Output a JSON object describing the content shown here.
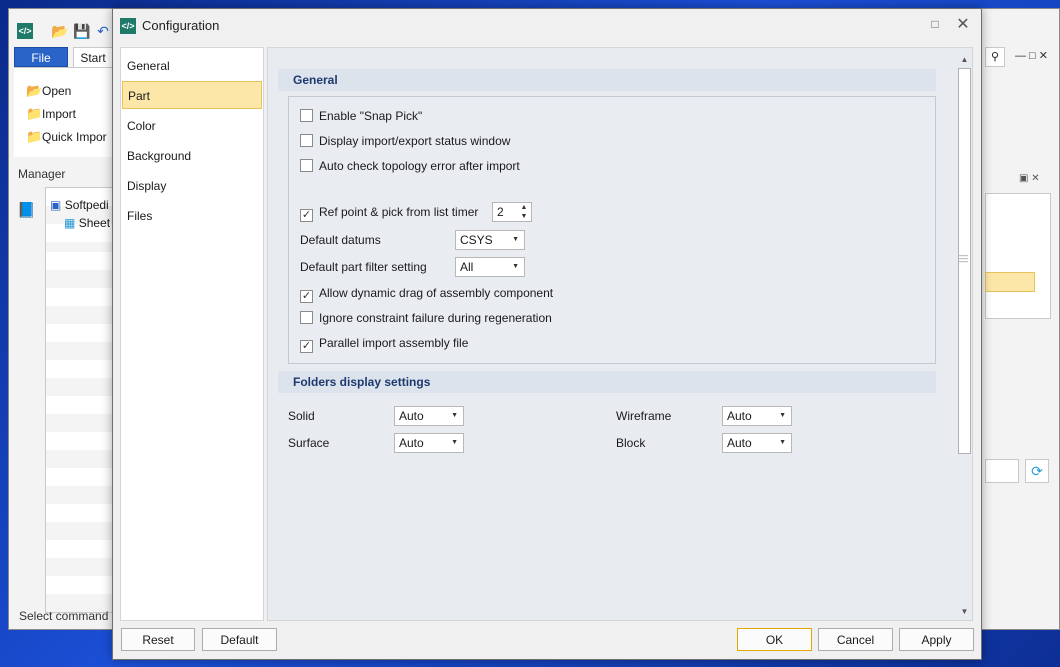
{
  "app": {
    "tabs": {
      "file": "File",
      "start": "Start"
    },
    "ribbon": {
      "open": "Open",
      "import": "Import",
      "quick_import": "Quick Impor"
    },
    "manager_label": "Manager",
    "tree": {
      "item1": "Softpedi",
      "item2": "Sheet"
    },
    "status": "Select command o"
  },
  "dialog": {
    "title": "Configuration",
    "nav": [
      "General",
      "Part",
      "Color",
      "Background",
      "Display",
      "Files"
    ],
    "nav_selected": "Part",
    "sections": {
      "general": "General",
      "folders": "Folders display settings"
    },
    "options": {
      "snap_pick": {
        "label": "Enable \"Snap Pick\"",
        "checked": false
      },
      "status_window": {
        "label": "Display import/export status window",
        "checked": false
      },
      "topology": {
        "label": "Auto check topology error after import",
        "checked": false
      },
      "ref_point": {
        "label": "Ref point & pick from list timer",
        "checked": true,
        "value": "2"
      },
      "dynamic_drag": {
        "label": "Allow dynamic drag of assembly component",
        "checked": true
      },
      "ignore_constraint": {
        "label": "Ignore constraint failure during regeneration",
        "checked": false
      },
      "parallel_import": {
        "label": "Parallel import assembly file",
        "checked": true
      }
    },
    "fields": {
      "default_datums": {
        "label": "Default datums",
        "value": "CSYS"
      },
      "default_part_filter": {
        "label": "Default part filter setting",
        "value": "All"
      }
    },
    "folders": {
      "solid": {
        "label": "Solid",
        "value": "Auto"
      },
      "surface": {
        "label": "Surface",
        "value": "Auto"
      },
      "wireframe": {
        "label": "Wireframe",
        "value": "Auto"
      },
      "block": {
        "label": "Block",
        "value": "Auto"
      }
    },
    "buttons": {
      "reset": "Reset",
      "default": "Default",
      "ok": "OK",
      "cancel": "Cancel",
      "apply": "Apply"
    }
  }
}
